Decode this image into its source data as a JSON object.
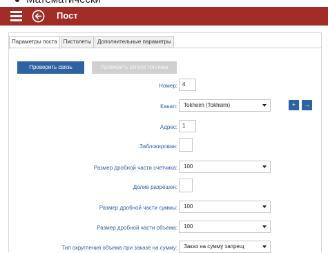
{
  "top_caption": {
    "text": "Математически"
  },
  "titlebar": {
    "title": "Пост"
  },
  "tabs": [
    {
      "label": "Параметры поста",
      "active": true
    },
    {
      "label": "Пистолеты",
      "active": false
    },
    {
      "label": "Дополнительные параметры",
      "active": false
    }
  ],
  "buttons": {
    "check_connection": "Проверить связь",
    "check_fuel_release": "Проверить отпуск топлива"
  },
  "form": {
    "number_label": "Номер:",
    "number_value": "4",
    "channel_label": "Канал:",
    "channel_value": "Tokheim (Tokheim)",
    "address_label": "Адрес:",
    "address_value": "1",
    "blocked_label": "Заблокирован:",
    "counter_fraction_label": "Размер дробной части счетчика:",
    "counter_fraction_value": "100",
    "topup_allowed_label": "Долив разрешен:",
    "sum_fraction_label": "Размер дробной части суммы:",
    "sum_fraction_value": "100",
    "volume_fraction_label": "Размер дробной части объема:",
    "volume_fraction_value": "100",
    "rounding_label": "Тип округления объема при заказе на сумму:",
    "rounding_value": "Заказ на сумму запрещ"
  },
  "icons": {
    "add": "+",
    "go": "→"
  },
  "colors": {
    "titlebar": "#a12c25",
    "accent": "#2d62a3",
    "label": "#2d62a3"
  }
}
